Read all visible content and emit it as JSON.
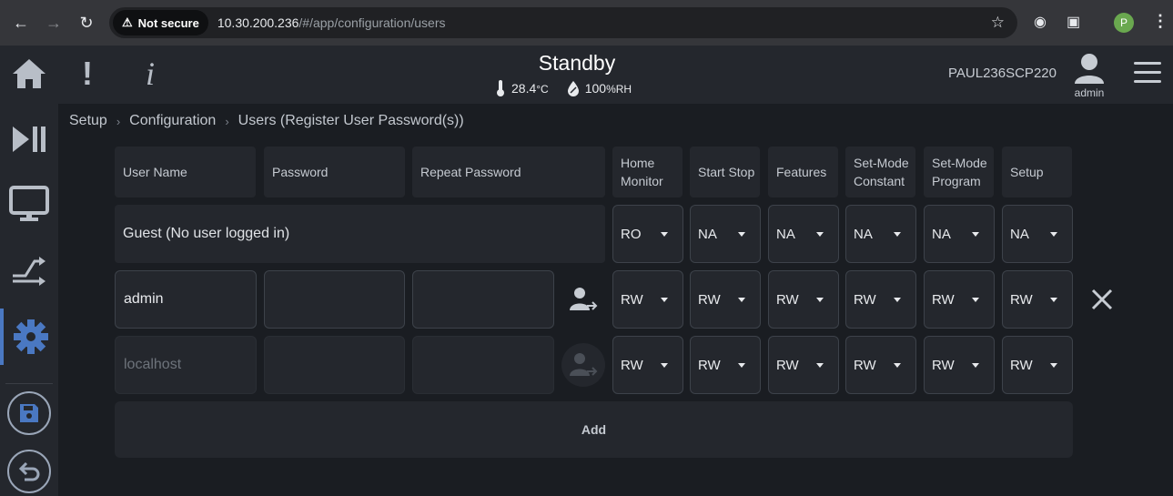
{
  "browser": {
    "security_label": "Not secure",
    "url_host": "10.30.200.236",
    "url_path": "/#/app/configuration/users",
    "profile_initial": "P"
  },
  "header": {
    "status": "Standby",
    "temperature": "28.4",
    "temperature_unit": "°C",
    "humidity": "100",
    "humidity_unit": "%RH",
    "device_name": "PAUL236SCP220",
    "user": "admin"
  },
  "breadcrumb": [
    "Setup",
    "Configuration",
    "Users (Register User Password(s))"
  ],
  "columns": {
    "user_name": "User Name",
    "password": "Password",
    "repeat_password": "Repeat Password",
    "perms": [
      "Home\nMonitor",
      "Start Stop",
      "Features",
      "Set-Mode\nConstant",
      "Set-Mode\nProgram",
      "Setup"
    ]
  },
  "guest": {
    "label": "Guest (No user logged in)",
    "perms": [
      "RO",
      "NA",
      "NA",
      "NA",
      "NA",
      "NA"
    ]
  },
  "users": [
    {
      "name": "admin",
      "perms": [
        "RW",
        "RW",
        "RW",
        "RW",
        "RW",
        "RW"
      ]
    },
    {
      "name": "localhost",
      "perms": [
        "RW",
        "RW",
        "RW",
        "RW",
        "RW",
        "RW"
      ]
    }
  ],
  "add_label": "Add",
  "colors": {
    "accent": "#4a78c2",
    "background": "#1a1d22",
    "panel": "#24272d"
  }
}
